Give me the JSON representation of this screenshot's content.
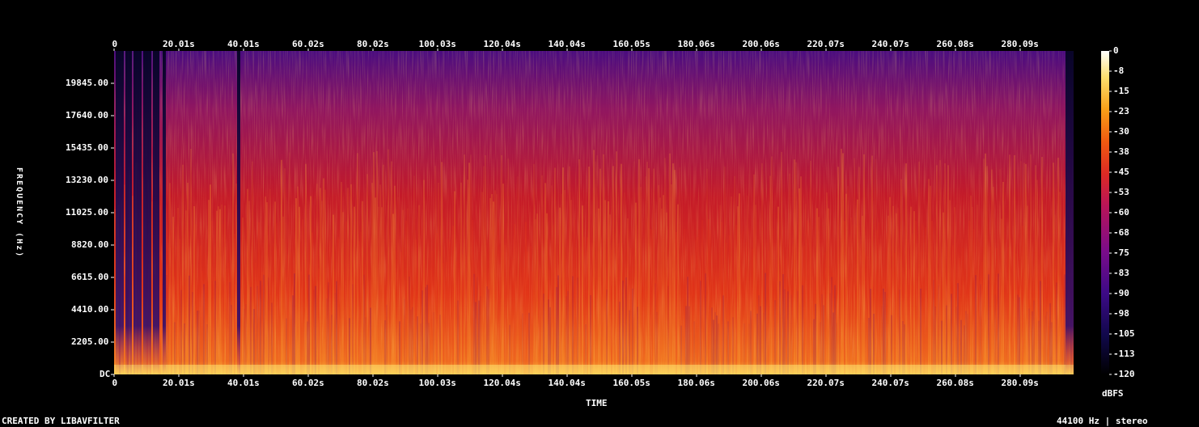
{
  "chart_data": {
    "type": "heatmap",
    "title": "",
    "xlabel": "TIME",
    "ylabel": "FREQUENCY (Hz)",
    "x_ticks": [
      "0",
      "20.01s",
      "40.01s",
      "60.02s",
      "80.02s",
      "100.03s",
      "120.04s",
      "140.04s",
      "160.05s",
      "180.06s",
      "200.06s",
      "220.07s",
      "240.07s",
      "260.08s",
      "280.09s"
    ],
    "y_ticks": [
      "DC",
      "2205.00",
      "4410.00",
      "6615.00",
      "8820.00",
      "11025.00",
      "13230.00",
      "15435.00",
      "17640.00",
      "19845.00"
    ],
    "y_range": [
      0,
      22050
    ],
    "duration_s": 298.5,
    "colorbar": {
      "label": "dBFS",
      "ticks": [
        "0",
        "-8",
        "-15",
        "-23",
        "-30",
        "-38",
        "-45",
        "-53",
        "-60",
        "-68",
        "-75",
        "-83",
        "-90",
        "-98",
        "-105",
        "-113",
        "-120"
      ],
      "range": [
        -120,
        0
      ],
      "colors": [
        "#000000",
        "#1a0a6e",
        "#5a0a8c",
        "#a01478",
        "#d8282a",
        "#f05a10",
        "#f8a81c",
        "#fff0a0",
        "#ffffff"
      ]
    }
  },
  "footer": {
    "left": "CREATED BY LIBAVFILTER",
    "right": "44100 Hz | stereo"
  }
}
